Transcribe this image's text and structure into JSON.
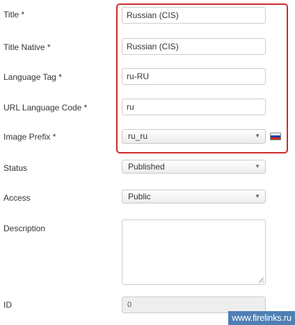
{
  "fields": {
    "title": {
      "label": "Title *",
      "value": "Russian (CIS)"
    },
    "title_native": {
      "label": "Title Native *",
      "value": "Russian (CIS)"
    },
    "language_tag": {
      "label": "Language Tag *",
      "value": "ru-RU"
    },
    "url_code": {
      "label": "URL Language Code *",
      "value": "ru"
    },
    "image_prefix": {
      "label": "Image Prefix *",
      "value": "ru_ru",
      "flag_icon": "russia-flag-icon",
      "flag_colors": [
        "#ffffff",
        "#0039a6",
        "#d52b1e"
      ]
    },
    "status": {
      "label": "Status",
      "value": "Published"
    },
    "access": {
      "label": "Access",
      "value": "Public"
    },
    "description": {
      "label": "Description",
      "value": ""
    },
    "id": {
      "label": "ID",
      "value": "0"
    }
  },
  "highlight_color": "#cc2b2b",
  "watermark": "www.firelinks.ru"
}
